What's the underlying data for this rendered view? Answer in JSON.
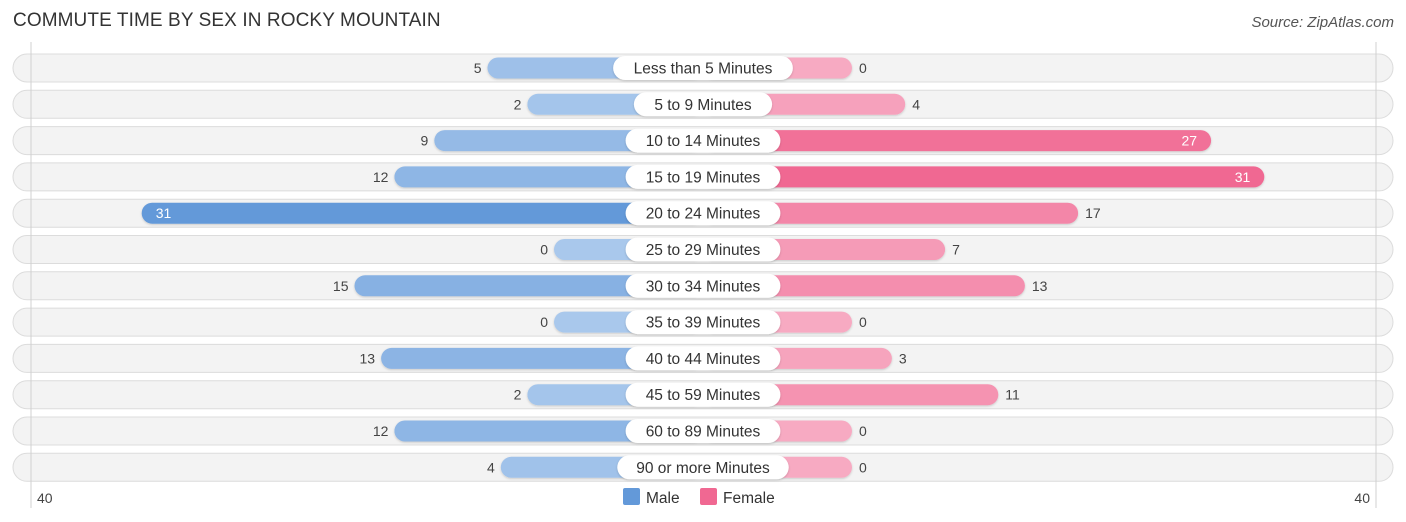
{
  "chart_data": {
    "type": "bar",
    "orientation": "horizontal-diverging",
    "title": "COMMUTE TIME BY SEX IN ROCKY MOUNTAIN",
    "source": "Source: ZipAtlas.com",
    "categories": [
      "Less than 5 Minutes",
      "5 to 9 Minutes",
      "10 to 14 Minutes",
      "15 to 19 Minutes",
      "20 to 24 Minutes",
      "25 to 29 Minutes",
      "30 to 34 Minutes",
      "35 to 39 Minutes",
      "40 to 44 Minutes",
      "45 to 59 Minutes",
      "60 to 89 Minutes",
      "90 or more Minutes"
    ],
    "series": [
      {
        "name": "Male",
        "side": "left",
        "color": "#6399d9",
        "color_light": "#a9c8ec",
        "values": [
          5,
          2,
          9,
          12,
          31,
          0,
          15,
          0,
          13,
          2,
          12,
          4
        ]
      },
      {
        "name": "Female",
        "side": "right",
        "color": "#f06892",
        "color_light": "#f7aac2",
        "values": [
          0,
          4,
          27,
          31,
          17,
          7,
          13,
          0,
          3,
          11,
          0,
          0
        ]
      }
    ],
    "axis": {
      "left_label": "40",
      "right_label": "40",
      "max": 40
    },
    "legend": {
      "position": "bottom-center",
      "items": [
        "Male",
        "Female"
      ]
    },
    "xlabel": "",
    "ylabel": ""
  }
}
